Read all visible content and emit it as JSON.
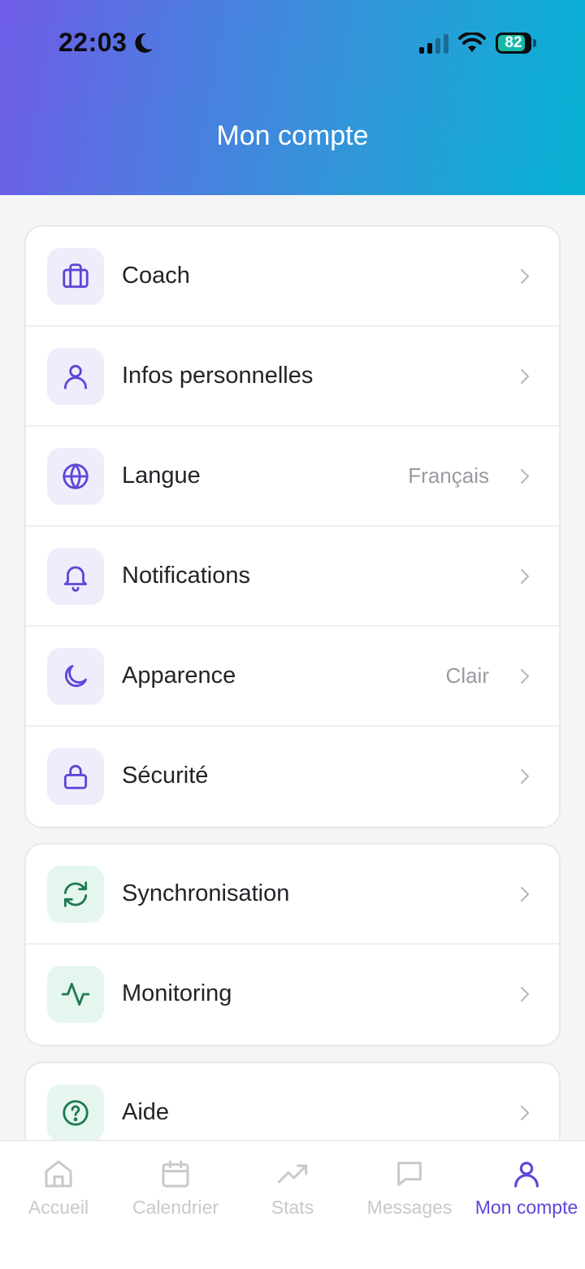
{
  "status_bar": {
    "time": "22:03",
    "battery": "82",
    "icons": [
      "moon-icon",
      "signal-icon",
      "wifi-icon",
      "battery-icon"
    ]
  },
  "header": {
    "title": "Mon compte",
    "gradient_colors": [
      "#6f5ce6",
      "#06b3d4"
    ]
  },
  "sections": [
    {
      "items": [
        {
          "label": "Coach",
          "icon": "briefcase-icon",
          "value": ""
        },
        {
          "label": "Infos personnelles",
          "icon": "user-icon",
          "value": ""
        },
        {
          "label": "Langue",
          "icon": "globe-icon",
          "value": "Français"
        },
        {
          "label": "Notifications",
          "icon": "bell-icon",
          "value": ""
        },
        {
          "label": "Apparence",
          "icon": "moon-icon",
          "value": "Clair"
        },
        {
          "label": "Sécurité",
          "icon": "lock-icon",
          "value": ""
        }
      ]
    },
    {
      "items": [
        {
          "label": "Synchronisation",
          "icon": "sync-icon",
          "value": ""
        },
        {
          "label": "Monitoring",
          "icon": "activity-icon",
          "value": ""
        }
      ]
    },
    {
      "items": [
        {
          "label": "Aide",
          "icon": "help-circle-icon",
          "value": ""
        }
      ]
    }
  ],
  "tabbar": {
    "tabs": [
      {
        "label": "Accueil",
        "icon": "home-icon",
        "active": false
      },
      {
        "label": "Calendrier",
        "icon": "calendar-icon",
        "active": false
      },
      {
        "label": "Stats",
        "icon": "trending-up-icon",
        "active": false
      },
      {
        "label": "Messages",
        "icon": "chat-icon",
        "active": false
      },
      {
        "label": "Mon compte",
        "icon": "user-icon",
        "active": true
      }
    ]
  },
  "colors": {
    "accent": "#5b48d6",
    "icon_purple": "#5b48d6",
    "icon_purple_bg": "#efedfb",
    "icon_green": "#1f7a52",
    "icon_green_bg": "#e5f6ef",
    "tab_inactive": "#c8c8ce"
  }
}
